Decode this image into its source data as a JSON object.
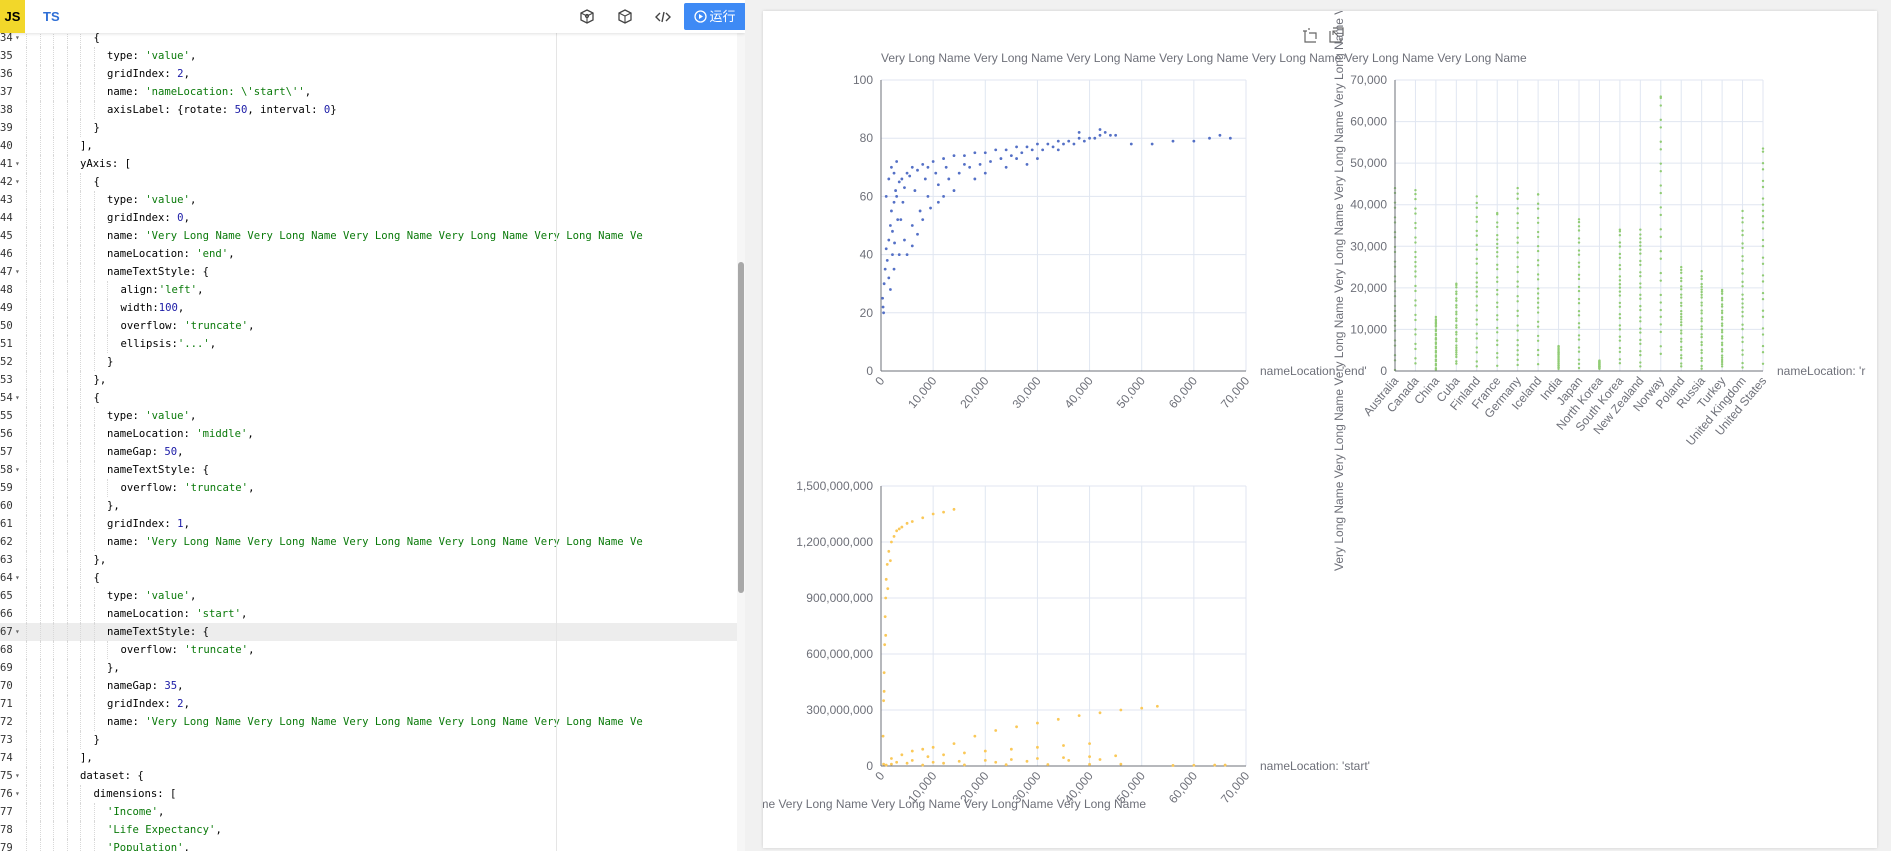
{
  "toolbar": {
    "tabs": [
      "JS",
      "TS"
    ],
    "icons": [
      "cube-outline-icon",
      "box-icon",
      "code-icon",
      "play-circle-icon"
    ],
    "run_label": "运行"
  },
  "editor": {
    "highlighted_line": 67,
    "lines": [
      {
        "n": 34,
        "fold": true,
        "indent": 5,
        "text": "{"
      },
      {
        "n": 35,
        "fold": false,
        "indent": 6,
        "text": "type: 'value',"
      },
      {
        "n": 36,
        "fold": false,
        "indent": 6,
        "text": "gridIndex: 2,"
      },
      {
        "n": 37,
        "fold": false,
        "indent": 6,
        "text": "name: 'nameLocation: \\'start\\'',"
      },
      {
        "n": 38,
        "fold": false,
        "indent": 6,
        "text": "axisLabel: {rotate: 50, interval: 0}"
      },
      {
        "n": 39,
        "fold": false,
        "indent": 5,
        "text": "}"
      },
      {
        "n": 40,
        "fold": false,
        "indent": 4,
        "text": "],"
      },
      {
        "n": 41,
        "fold": true,
        "indent": 4,
        "text": "yAxis: ["
      },
      {
        "n": 42,
        "fold": true,
        "indent": 5,
        "text": "{"
      },
      {
        "n": 43,
        "fold": false,
        "indent": 6,
        "text": "type: 'value',"
      },
      {
        "n": 44,
        "fold": false,
        "indent": 6,
        "text": "gridIndex: 0,"
      },
      {
        "n": 45,
        "fold": false,
        "indent": 6,
        "text": "name: 'Very Long Name Very Long Name Very Long Name Very Long Name Very Long Name Ve"
      },
      {
        "n": 46,
        "fold": false,
        "indent": 6,
        "text": "nameLocation: 'end',"
      },
      {
        "n": 47,
        "fold": true,
        "indent": 6,
        "text": "nameTextStyle: {"
      },
      {
        "n": 48,
        "fold": false,
        "indent": 7,
        "text": "align:'left',"
      },
      {
        "n": 49,
        "fold": false,
        "indent": 7,
        "text": "width:100,"
      },
      {
        "n": 50,
        "fold": false,
        "indent": 7,
        "text": "overflow: 'truncate',"
      },
      {
        "n": 51,
        "fold": false,
        "indent": 7,
        "text": "ellipsis:'...',"
      },
      {
        "n": 52,
        "fold": false,
        "indent": 6,
        "text": "}"
      },
      {
        "n": 53,
        "fold": false,
        "indent": 5,
        "text": "},"
      },
      {
        "n": 54,
        "fold": true,
        "indent": 5,
        "text": "{"
      },
      {
        "n": 55,
        "fold": false,
        "indent": 6,
        "text": "type: 'value',"
      },
      {
        "n": 56,
        "fold": false,
        "indent": 6,
        "text": "nameLocation: 'middle',"
      },
      {
        "n": 57,
        "fold": false,
        "indent": 6,
        "text": "nameGap: 50,"
      },
      {
        "n": 58,
        "fold": true,
        "indent": 6,
        "text": "nameTextStyle: {"
      },
      {
        "n": 59,
        "fold": false,
        "indent": 7,
        "text": "overflow: 'truncate',"
      },
      {
        "n": 60,
        "fold": false,
        "indent": 6,
        "text": "},"
      },
      {
        "n": 61,
        "fold": false,
        "indent": 6,
        "text": "gridIndex: 1,"
      },
      {
        "n": 62,
        "fold": false,
        "indent": 6,
        "text": "name: 'Very Long Name Very Long Name Very Long Name Very Long Name Very Long Name Ve"
      },
      {
        "n": 63,
        "fold": false,
        "indent": 5,
        "text": "},"
      },
      {
        "n": 64,
        "fold": true,
        "indent": 5,
        "text": "{"
      },
      {
        "n": 65,
        "fold": false,
        "indent": 6,
        "text": "type: 'value',"
      },
      {
        "n": 66,
        "fold": false,
        "indent": 6,
        "text": "nameLocation: 'start',"
      },
      {
        "n": 67,
        "fold": true,
        "indent": 6,
        "text": "nameTextStyle: {"
      },
      {
        "n": 68,
        "fold": false,
        "indent": 7,
        "text": "overflow: 'truncate',"
      },
      {
        "n": 69,
        "fold": false,
        "indent": 6,
        "text": "},"
      },
      {
        "n": 70,
        "fold": false,
        "indent": 6,
        "text": "nameGap: 35,"
      },
      {
        "n": 71,
        "fold": false,
        "indent": 6,
        "text": "gridIndex: 2,"
      },
      {
        "n": 72,
        "fold": false,
        "indent": 6,
        "text": "name: 'Very Long Name Very Long Name Very Long Name Very Long Name Very Long Name Ve"
      },
      {
        "n": 73,
        "fold": false,
        "indent": 5,
        "text": "}"
      },
      {
        "n": 74,
        "fold": false,
        "indent": 4,
        "text": "],"
      },
      {
        "n": 75,
        "fold": true,
        "indent": 4,
        "text": "dataset: {"
      },
      {
        "n": 76,
        "fold": true,
        "indent": 5,
        "text": "dimensions: ["
      },
      {
        "n": 77,
        "fold": false,
        "indent": 6,
        "text": "'Income',"
      },
      {
        "n": 78,
        "fold": false,
        "indent": 6,
        "text": "'Life Expectancy',"
      },
      {
        "n": 79,
        "fold": false,
        "indent": 6,
        "text": "'Population',"
      }
    ]
  },
  "preview": {
    "tool_icons": [
      "data-zoom-icon",
      "zoom-reset-icon"
    ]
  },
  "chart_data": [
    {
      "type": "scatter",
      "title": "",
      "ylabel": "Very Long Name Very Long Name Very Long Name Very Long Name Very Long Name Very Long Name Very Long Name",
      "xlabel": "nameLocation: 'end'",
      "color": "#5470c6",
      "xlim": [
        0,
        70000
      ],
      "ylim": [
        0,
        100
      ],
      "xticks": [
        "0",
        "10,000",
        "20,000",
        "30,000",
        "40,000",
        "50,000",
        "60,000",
        "70,000"
      ],
      "yticks": [
        "0",
        "20",
        "40",
        "60",
        "80",
        "100"
      ],
      "points": [
        [
          300,
          25
        ],
        [
          400,
          22
        ],
        [
          500,
          20
        ],
        [
          600,
          30
        ],
        [
          800,
          35
        ],
        [
          1000,
          42
        ],
        [
          1200,
          38
        ],
        [
          1500,
          45
        ],
        [
          1800,
          50
        ],
        [
          2000,
          55
        ],
        [
          2200,
          48
        ],
        [
          2500,
          58
        ],
        [
          2800,
          62
        ],
        [
          3000,
          60
        ],
        [
          3200,
          52
        ],
        [
          3500,
          65
        ],
        [
          4000,
          66
        ],
        [
          4500,
          63
        ],
        [
          5000,
          68
        ],
        [
          5500,
          67
        ],
        [
          6000,
          70
        ],
        [
          7000,
          69
        ],
        [
          8000,
          71
        ],
        [
          9000,
          70
        ],
        [
          10000,
          72
        ],
        [
          12000,
          73
        ],
        [
          14000,
          74
        ],
        [
          16000,
          74
        ],
        [
          18000,
          75
        ],
        [
          20000,
          75
        ],
        [
          22000,
          76
        ],
        [
          24000,
          76
        ],
        [
          26000,
          77
        ],
        [
          28000,
          77
        ],
        [
          30000,
          78
        ],
        [
          32000,
          78
        ],
        [
          34000,
          79
        ],
        [
          36000,
          79
        ],
        [
          38000,
          80
        ],
        [
          40000,
          80
        ],
        [
          42000,
          81
        ],
        [
          44000,
          81
        ],
        [
          48000,
          78
        ],
        [
          52000,
          78
        ],
        [
          56000,
          79
        ],
        [
          60000,
          79
        ],
        [
          63000,
          80
        ],
        [
          65000,
          81
        ],
        [
          67000,
          80
        ],
        [
          1000,
          60
        ],
        [
          1500,
          66
        ],
        [
          2000,
          70
        ],
        [
          2500,
          68
        ],
        [
          3000,
          72
        ],
        [
          1800,
          28
        ],
        [
          2500,
          35
        ],
        [
          3500,
          40
        ],
        [
          4500,
          45
        ],
        [
          6000,
          50
        ],
        [
          7500,
          55
        ],
        [
          9000,
          60
        ],
        [
          11000,
          64
        ],
        [
          13000,
          66
        ],
        [
          15000,
          68
        ],
        [
          17000,
          70
        ],
        [
          19000,
          71
        ],
        [
          21000,
          72
        ],
        [
          23000,
          73
        ],
        [
          25000,
          74
        ],
        [
          27000,
          75
        ],
        [
          29000,
          76
        ],
        [
          31000,
          76
        ],
        [
          33000,
          77
        ],
        [
          35000,
          78
        ],
        [
          37000,
          78
        ],
        [
          39000,
          79
        ],
        [
          41000,
          80
        ],
        [
          43000,
          82
        ],
        [
          45000,
          81
        ],
        [
          5000,
          40
        ],
        [
          6000,
          43
        ],
        [
          7000,
          47
        ],
        [
          8000,
          52
        ],
        [
          9500,
          56
        ],
        [
          11000,
          58
        ],
        [
          1500,
          32
        ],
        [
          2200,
          40
        ],
        [
          2600,
          44
        ],
        [
          3800,
          52
        ],
        [
          4200,
          58
        ],
        [
          6500,
          62
        ],
        [
          8500,
          66
        ],
        [
          10500,
          68
        ],
        [
          12500,
          70
        ],
        [
          16000,
          71
        ],
        [
          26000,
          73
        ],
        [
          34000,
          76
        ],
        [
          38000,
          82
        ],
        [
          42000,
          83
        ],
        [
          24000,
          70
        ],
        [
          28000,
          71
        ],
        [
          30000,
          73
        ],
        [
          20000,
          68
        ],
        [
          18000,
          66
        ],
        [
          14000,
          62
        ],
        [
          12000,
          60
        ]
      ]
    },
    {
      "type": "scatter",
      "title": "",
      "ylabel": "Very Long Name Very Long Name Very Long Name Very Long Name Very Long Name Very Long Name Very Long Name",
      "xlabel": "nameLocation: 'r",
      "color": "#91cc75",
      "categories": [
        "Australia",
        "Canada",
        "China",
        "Cuba",
        "Finland",
        "France",
        "Germany",
        "Iceland",
        "India",
        "Japan",
        "North Korea",
        "South Korea",
        "New Zealand",
        "Norway",
        "Poland",
        "Russia",
        "Turkey",
        "United Kingdom",
        "United States"
      ],
      "ylim": [
        0,
        70000
      ],
      "yticks": [
        "0",
        "10,000",
        "20,000",
        "30,000",
        "40,000",
        "50,000",
        "60,000",
        "70,000"
      ],
      "ranges": [
        [
          200,
          44000
        ],
        [
          500,
          43500
        ],
        [
          200,
          13000
        ],
        [
          1000,
          21000
        ],
        [
          500,
          42000
        ],
        [
          500,
          38000
        ],
        [
          500,
          44000
        ],
        [
          500,
          42500
        ],
        [
          500,
          6000
        ],
        [
          500,
          36500
        ],
        [
          500,
          2500
        ],
        [
          500,
          34000
        ],
        [
          500,
          34000
        ],
        [
          1000,
          66000
        ],
        [
          500,
          25000
        ],
        [
          500,
          24000
        ],
        [
          500,
          19500
        ],
        [
          500,
          38500
        ],
        [
          1000,
          53500
        ]
      ]
    },
    {
      "type": "scatter",
      "title": "",
      "ylabel": "Very Long Name Very Long Name Very Long Name Very Long Name Very Long Name Very Long Name Very Long Name",
      "xlabel": "nameLocation: 'start'",
      "color": "#fac858",
      "xlim": [
        0,
        70000
      ],
      "ylim": [
        0,
        1500000000
      ],
      "xticks": [
        "0",
        "10,000",
        "20,000",
        "30,000",
        "40,000",
        "50,000",
        "60,000",
        "70,000"
      ],
      "yticks": [
        "0",
        "300,000,000",
        "600,000,000",
        "900,000,000",
        "1,200,000,000",
        "1,500,000,000"
      ],
      "points": [
        [
          400,
          160000000
        ],
        [
          500,
          350000000
        ],
        [
          600,
          500000000
        ],
        [
          700,
          650000000
        ],
        [
          800,
          800000000
        ],
        [
          900,
          900000000
        ],
        [
          1000,
          1000000000
        ],
        [
          1200,
          1080000000
        ],
        [
          1500,
          1150000000
        ],
        [
          2000,
          1200000000
        ],
        [
          2500,
          1230000000
        ],
        [
          3000,
          1260000000
        ],
        [
          4000,
          1280000000
        ],
        [
          5000,
          1300000000
        ],
        [
          6000,
          1310000000
        ],
        [
          8000,
          1330000000
        ],
        [
          10000,
          1350000000
        ],
        [
          12000,
          1360000000
        ],
        [
          14000,
          1375000000
        ],
        [
          600,
          400000000
        ],
        [
          900,
          700000000
        ],
        [
          1300,
          950000000
        ],
        [
          1800,
          1100000000
        ],
        [
          3500,
          1270000000
        ],
        [
          500,
          10000000
        ],
        [
          2000,
          40000000
        ],
        [
          4000,
          60000000
        ],
        [
          6000,
          80000000
        ],
        [
          8000,
          90000000
        ],
        [
          10000,
          100000000
        ],
        [
          14000,
          120000000
        ],
        [
          18000,
          160000000
        ],
        [
          22000,
          190000000
        ],
        [
          26000,
          210000000
        ],
        [
          30000,
          230000000
        ],
        [
          34000,
          250000000
        ],
        [
          38000,
          270000000
        ],
        [
          42000,
          285000000
        ],
        [
          46000,
          300000000
        ],
        [
          50000,
          310000000
        ],
        [
          53000,
          320000000
        ],
        [
          3000,
          20000000
        ],
        [
          6000,
          30000000
        ],
        [
          9000,
          50000000
        ],
        [
          12000,
          60000000
        ],
        [
          16000,
          70000000
        ],
        [
          20000,
          80000000
        ],
        [
          25000,
          90000000
        ],
        [
          30000,
          100000000
        ],
        [
          35000,
          110000000
        ],
        [
          40000,
          120000000
        ],
        [
          2000,
          10000000
        ],
        [
          5000,
          15000000
        ],
        [
          10000,
          20000000
        ],
        [
          15000,
          25000000
        ],
        [
          20000,
          30000000
        ],
        [
          25000,
          35000000
        ],
        [
          30000,
          40000000
        ],
        [
          35000,
          45000000
        ],
        [
          40000,
          50000000
        ],
        [
          45000,
          55000000
        ],
        [
          1000,
          5000000
        ],
        [
          8000,
          5000000
        ],
        [
          16000,
          6000000
        ],
        [
          24000,
          7000000
        ],
        [
          32000,
          8000000
        ],
        [
          40000,
          9000000
        ],
        [
          46000,
          10000000
        ],
        [
          56000,
          3000000
        ],
        [
          60000,
          4000000
        ],
        [
          64000,
          5000000
        ],
        [
          66000,
          5000000
        ],
        [
          12000,
          15000000
        ],
        [
          22000,
          20000000
        ],
        [
          28000,
          25000000
        ],
        [
          36000,
          30000000
        ],
        [
          42000,
          35000000
        ]
      ]
    }
  ]
}
